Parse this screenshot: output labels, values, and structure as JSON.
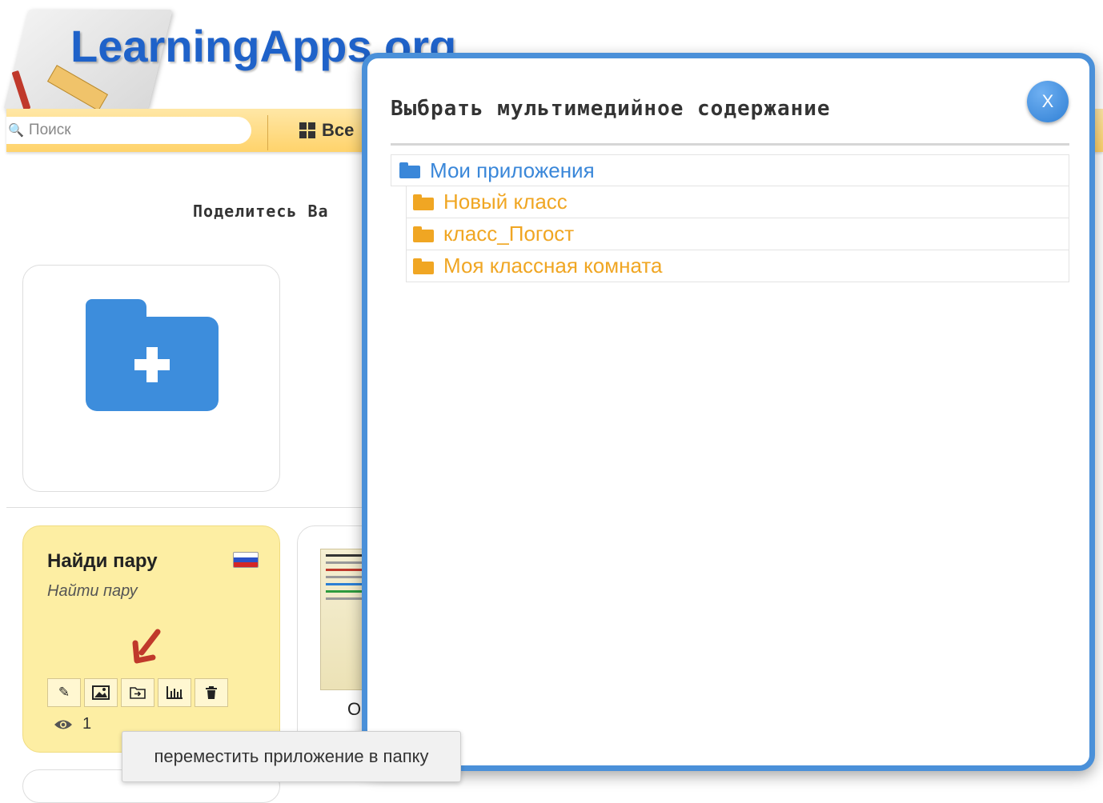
{
  "header": {
    "logo_text": "LearningApps.org",
    "search_placeholder": "Поиск",
    "nav_all": "Все",
    "share_text": "Поделитесь Ва"
  },
  "cards": {
    "app": {
      "title": "Найди пару",
      "subtitle": "Найти пару",
      "views": "1",
      "tools": [
        "pencil-icon",
        "image-icon",
        "move-to-folder-icon",
        "stats-icon",
        "trash-icon"
      ]
    },
    "app2": {
      "clipped_title": "О"
    }
  },
  "tooltip": {
    "text": "переместить приложение в папку"
  },
  "modal": {
    "title": "Выбрать мультимедийное содержание",
    "close_label": "X",
    "tree": {
      "root": "Мои приложения",
      "children": [
        "Новый класс",
        "класс_Погост",
        "Моя классная комната"
      ]
    }
  },
  "colors": {
    "accent_blue": "#4a90d9",
    "folder_orange": "#f0a623",
    "card_yellow": "#fdeea3",
    "nav_yellow": "#ffd36b"
  }
}
